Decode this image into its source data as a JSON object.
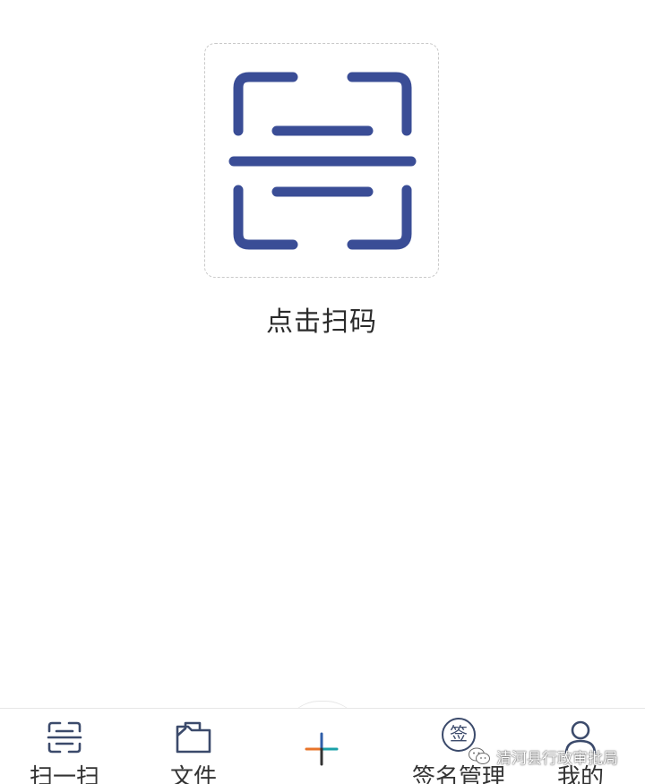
{
  "scan": {
    "label": "点击扫码",
    "icon": "scan-frame-icon",
    "color": "#3a4d96"
  },
  "tabbar": {
    "items": [
      {
        "label": "扫一扫",
        "icon": "scan-icon"
      },
      {
        "label": "文件",
        "icon": "folder-icon"
      },
      {
        "label": "",
        "icon": "add-icon"
      },
      {
        "label": "签名管理",
        "icon": "signature-badge-icon",
        "badge_text": "签"
      },
      {
        "label": "我的",
        "icon": "user-icon"
      }
    ]
  },
  "watermark": {
    "text": "清河县行政审批局",
    "icon": "wechat-icon"
  },
  "colors": {
    "accent": "#3a4d96",
    "tab_icon": "#3b4a6b",
    "plus_orange": "#e8742a",
    "plus_teal": "#1aa0a8",
    "plus_blue": "#2f5ea8",
    "plus_dark": "#333333"
  }
}
